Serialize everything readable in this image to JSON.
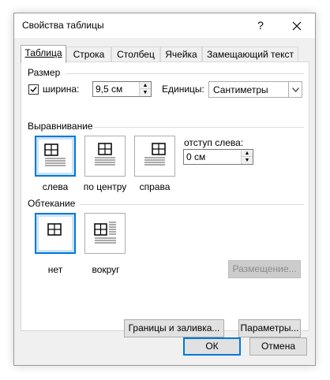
{
  "dialog": {
    "title": "Свойства таблицы",
    "help_symbol": "?",
    "close_symbol": "✕"
  },
  "tabs": [
    {
      "label": "Таблица",
      "active": true
    },
    {
      "label": "Строка",
      "active": false
    },
    {
      "label": "Столбец",
      "active": false
    },
    {
      "label": "Ячейка",
      "active": false
    },
    {
      "label": "Замещающий текст",
      "active": false
    }
  ],
  "size": {
    "group_label": "Размер",
    "width_checkbox_checked": true,
    "width_label": "ширина:",
    "width_value": "9,5 см",
    "units_label": "Единицы:",
    "units_value": "Сантиметры"
  },
  "alignment": {
    "group_label": "Выравнивание",
    "options": [
      {
        "label": "слева",
        "selected": true
      },
      {
        "label": "по центру",
        "selected": false
      },
      {
        "label": "справа",
        "selected": false
      }
    ],
    "indent_label": "отступ слева:",
    "indent_value": "0 см"
  },
  "wrapping": {
    "group_label": "Обтекание",
    "options": [
      {
        "label": "нет",
        "selected": true
      },
      {
        "label": "вокруг",
        "selected": false
      }
    ],
    "positioning_button": "Размещение..."
  },
  "buttons": {
    "borders": "Границы и заливка...",
    "options": "Параметры...",
    "ok": "ОК",
    "cancel": "Отмена"
  },
  "colors": {
    "accent": "#0078d7",
    "selected_bg": "#cce4f7"
  }
}
